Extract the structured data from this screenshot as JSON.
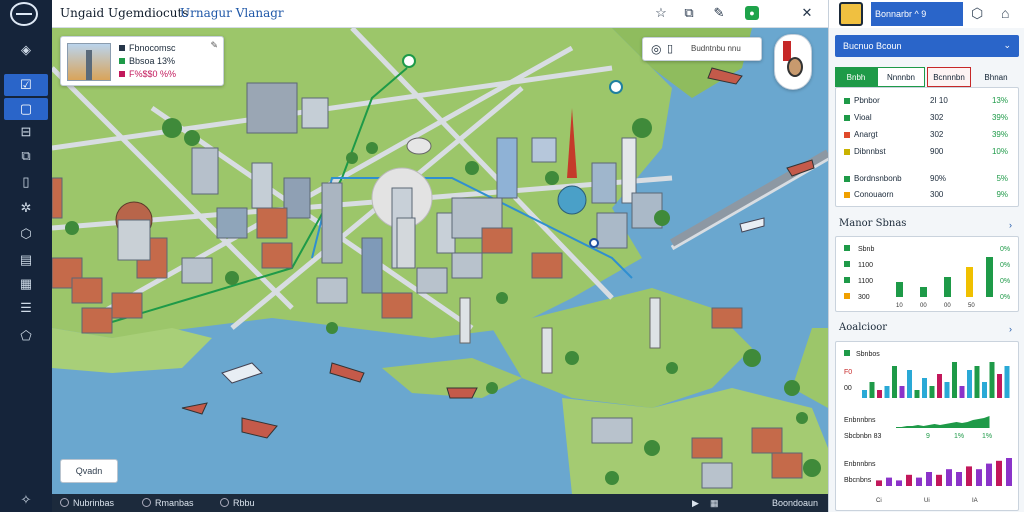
{
  "app": {
    "title": "Ungaid Ugemdiocuts",
    "subtitle": "Urnagur Vlanagr"
  },
  "left_rail": [
    {
      "icon": "globe-icon"
    },
    {
      "icon": "check-list-icon"
    },
    {
      "icon": "document-icon"
    },
    {
      "icon": "minus-box-icon"
    },
    {
      "icon": "briefcase-icon"
    },
    {
      "icon": "book-icon"
    },
    {
      "icon": "share-icon"
    },
    {
      "icon": "cube-icon"
    },
    {
      "icon": "file-icon"
    },
    {
      "icon": "chart-icon"
    },
    {
      "icon": "list-icon"
    },
    {
      "icon": "shield-icon"
    },
    {
      "icon": "compass-icon"
    }
  ],
  "poi_card": {
    "title": "Fbnocomsc",
    "line2": "Bbsoa  13%",
    "line3": "F%$$0 %%",
    "colors": [
      "#1e9a48",
      "#c9a600",
      "#c2185b"
    ]
  },
  "search": {
    "label": "Budntnbu nnu"
  },
  "map_button": {
    "label": "Qvadn"
  },
  "statusbar": {
    "items": [
      "Nubrinbas",
      "Rmanbas",
      "Rbbu"
    ],
    "right_text": "Boondoaun"
  },
  "panel": {
    "user_label": "Bonnarbr ^ 9",
    "dropdown": "Bucnuo Bcoun",
    "tabs": [
      "Bnbh",
      "Nnnnbn",
      "Bcnnnbn",
      "Bhnan"
    ],
    "stats": [
      {
        "name": "Pbnbor",
        "value": "2I 10",
        "change": "13%",
        "color": "#1e9a48"
      },
      {
        "name": "Vioal",
        "value": "302",
        "change": "39%",
        "color": "#1e9a48"
      },
      {
        "name": "Anargt",
        "value": "302",
        "change": "39%",
        "color": "#e04a2b"
      },
      {
        "name": "Dibnnbst",
        "value": "900",
        "change": "10%",
        "color": "#c9b200"
      }
    ],
    "stats2": [
      {
        "name": "Bordnsnbonb",
        "value": "90%",
        "change": "5%",
        "color": "#1e9a48"
      },
      {
        "name": "Conouaorn",
        "value": "300",
        "change": "9%",
        "color": "#f0a000"
      }
    ],
    "section1": {
      "title": "Manor Sbnas",
      "rows": [
        {
          "label": "Sbnb",
          "value": "0%",
          "color": "#1e9a48"
        },
        {
          "label": "1100",
          "value": "0%",
          "color": "#1e9a48"
        },
        {
          "label": "1100",
          "value": "0%",
          "color": "#1e9a48"
        },
        {
          "label": "300",
          "value": "0%",
          "color": "#f0a000"
        }
      ],
      "bar_labels": [
        "10",
        "00",
        "00",
        "50"
      ]
    },
    "section2": {
      "title": "Aoalcioor",
      "legend": "Sbnbos",
      "legend2": "F0",
      "legend3": "00",
      "line_labels": [
        "Enbnnbns",
        "Sbcbnbn 83"
      ],
      "line_values": [
        "9",
        "1%",
        "1%"
      ],
      "bottom_labels": [
        "Enbnnbns",
        "Bbcnbns"
      ],
      "bottom_values": [
        "Ci",
        "Ui",
        "IA"
      ]
    }
  },
  "chart_data": [
    {
      "type": "bar",
      "series": [
        {
          "values": [
            2,
            4,
            2,
            3,
            8,
            3,
            7,
            2,
            5,
            3,
            6,
            4,
            9,
            3,
            7,
            8,
            4,
            9,
            6,
            8
          ]
        }
      ],
      "ylim": [
        0,
        10
      ]
    },
    {
      "type": "area",
      "series": [
        {
          "values": [
            1,
            1,
            2,
            2,
            3,
            2,
            3,
            4,
            3,
            4,
            5,
            6,
            5,
            6,
            8,
            9,
            10,
            12
          ]
        }
      ]
    },
    {
      "type": "bar",
      "series": [
        {
          "values": [
            2,
            3,
            2,
            4,
            3,
            5,
            4,
            6,
            5,
            7,
            6,
            8,
            9,
            10
          ]
        }
      ]
    }
  ]
}
